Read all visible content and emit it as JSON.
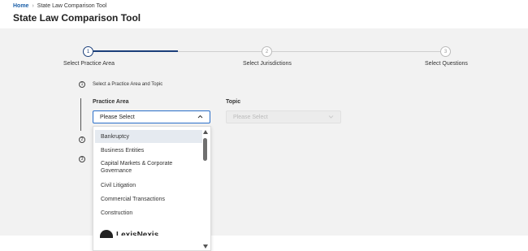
{
  "breadcrumb": {
    "home": "Home",
    "separator": "›",
    "current": "State Law Comparison Tool"
  },
  "page_title": "State Law Comparison Tool",
  "stepper": {
    "steps": [
      {
        "number": "1",
        "label": "Select Practice Area",
        "state": "active"
      },
      {
        "number": "2",
        "label": "Select Jurisdictions",
        "state": "inactive"
      },
      {
        "number": "3",
        "label": "Select Questions",
        "state": "inactive"
      }
    ]
  },
  "sections": [
    {
      "number": "1",
      "title": "Select a Practice Area and Topic"
    },
    {
      "number": "2"
    },
    {
      "number": "3"
    }
  ],
  "practice_area": {
    "label": "Practice Area",
    "value": "Please Select",
    "state": "open"
  },
  "topic": {
    "label": "Topic",
    "placeholder": "Please Select",
    "state": "disabled"
  },
  "dropdown": {
    "options": [
      "Bankruptcy",
      "Business Entities",
      "Capital Markets & Corporate Governance",
      "Civil Litigation",
      "Commercial Transactions",
      "Construction"
    ],
    "highlighted": "Bankruptcy"
  },
  "footer_peek": {
    "name": "LexisNexis"
  },
  "colors": {
    "accent": "#1b3f7a",
    "focus_border": "#2a6fc9",
    "link": "#1a5fa8",
    "background": "#f2f2f2"
  },
  "icons": {
    "breadcrumb_separator": "chevron-right-icon",
    "select_chevron": "chevron-up-icon",
    "disabled_chevron": "chevron-down-icon"
  }
}
